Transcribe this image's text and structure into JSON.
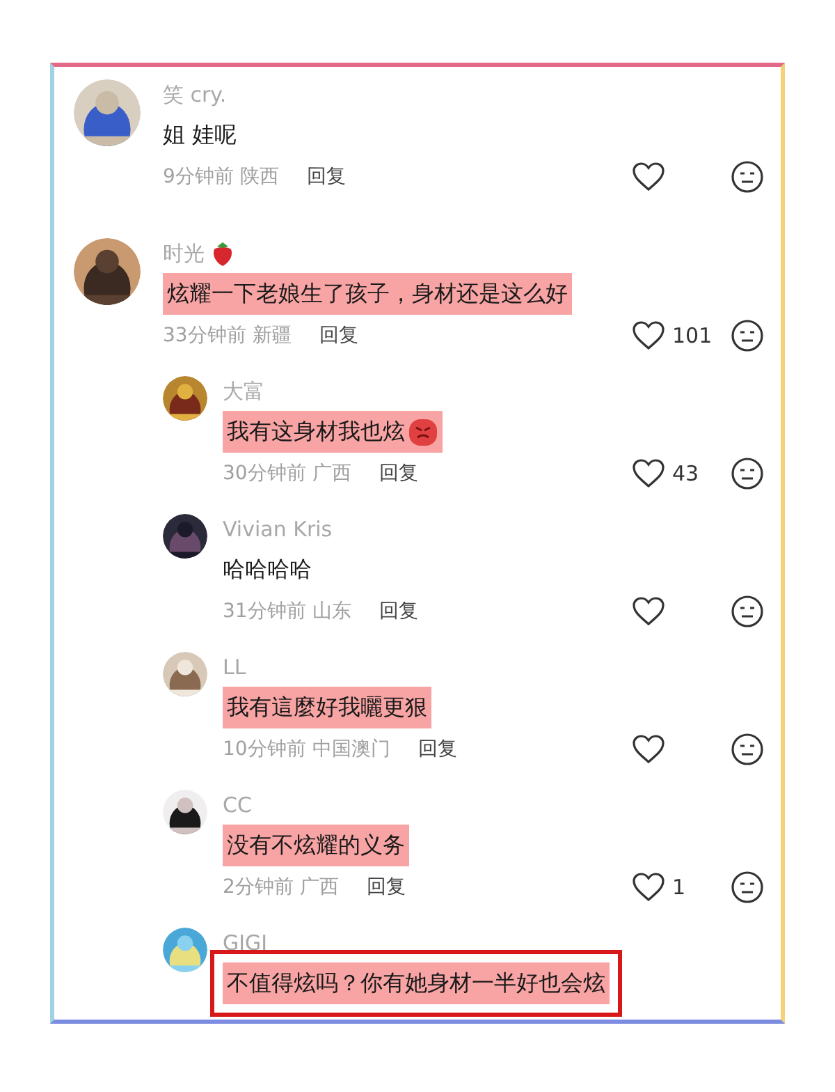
{
  "comments": [
    {
      "name": "笑 cry.",
      "text": "姐  娃呢",
      "time": "9分钟前 陕西",
      "reply": "回复",
      "highlighted": false
    },
    {
      "name": "时光",
      "name_emoji": true,
      "text": "炫耀一下老娘生了孩子，身材还是这么好",
      "time": "33分钟前 新疆",
      "reply": "回复",
      "likes": "101",
      "highlighted": true,
      "replies": [
        {
          "name": "大富",
          "text": "我有这身材我也炫",
          "text_emoji": true,
          "time": "30分钟前 广西",
          "reply": "回复",
          "likes": "43",
          "highlighted": true
        },
        {
          "name": "Vivian Kris",
          "text": "哈哈哈哈",
          "time": "31分钟前 山东",
          "reply": "回复",
          "highlighted": false
        },
        {
          "name": "LL",
          "text": "我有這麼好我曬更狠",
          "time": "10分钟前 中国澳门",
          "reply": "回复",
          "highlighted": true
        },
        {
          "name": "CC",
          "text": "没有不炫耀的义务",
          "time": "2分钟前 广西",
          "reply": "回复",
          "likes": "1",
          "highlighted": true
        },
        {
          "name": "GIGI",
          "text": "不值得炫吗？你有她身材一半好也会炫",
          "highlighted": true,
          "boxed": true
        }
      ]
    }
  ]
}
